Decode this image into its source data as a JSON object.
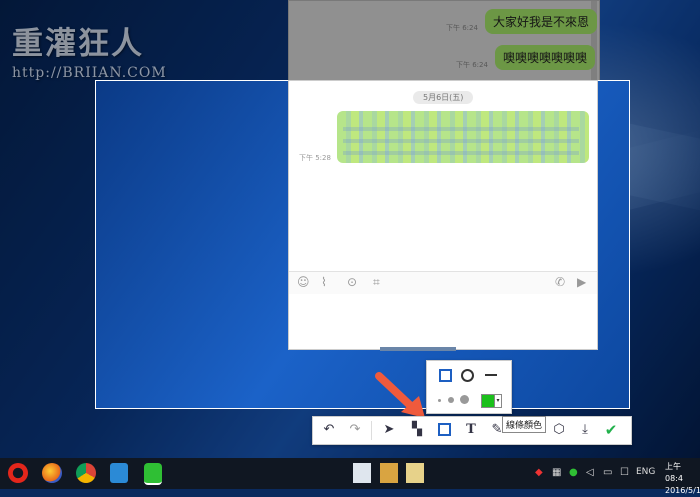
{
  "watermark": {
    "title": "重灌狂人",
    "url": "http://BRIIAN.COM"
  },
  "background_chat": {
    "messages": [
      {
        "text": "大家好我是不來恩",
        "time": "下午 6:24"
      },
      {
        "text": "噢噢噢噢噢噢噢",
        "time": "下午 6:24"
      }
    ]
  },
  "chat": {
    "date_label": "5月6日(五)",
    "message_time": "下午 5:28",
    "icons": [
      "smiley-icon",
      "paperclip-icon",
      "download-icon",
      "crop-icon",
      "phone-icon",
      "video-icon"
    ]
  },
  "shape_popup": {
    "shapes": [
      "rectangle-icon",
      "circle-icon",
      "line-icon"
    ],
    "selected_color": "#1bc01b"
  },
  "toolbar": {
    "tooltip": "線條顏色",
    "tools": [
      "undo-icon",
      "redo-icon",
      "arrow-tool-icon",
      "mosaic-icon",
      "rectangle-tool-icon",
      "text-tool-icon",
      "pen-tool-icon",
      "close-icon",
      "hexagon-icon",
      "download-icon",
      "confirm-icon"
    ]
  },
  "taskbar": {
    "tray_lang": "ENG",
    "clock_time": "上午 08:4",
    "clock_date": "2016/5/1"
  }
}
